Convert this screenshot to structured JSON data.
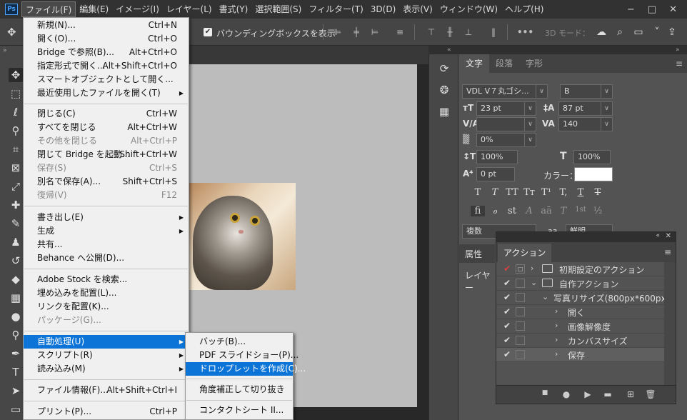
{
  "menubar": {
    "items": [
      "ファイル(F)",
      "編集(E)",
      "イメージ(I)",
      "レイヤー(L)",
      "書式(Y)",
      "選択範囲(S)",
      "フィルター(T)",
      "3D(D)",
      "表示(V)",
      "ウィンドウ(W)",
      "ヘルプ(H)"
    ],
    "logo": "Ps",
    "active_index": 0,
    "window_controls": {
      "minimize": "−",
      "maximize": "□",
      "close": "✕"
    }
  },
  "options_bar": {
    "show_bounding_box": "バウンディングボックスを表示",
    "bbox_checked": true,
    "mode_3d": "3D モード："
  },
  "file_menu": {
    "items": [
      {
        "label": "新規(N)...",
        "shortcut": "Ctrl+N"
      },
      {
        "label": "開く(O)...",
        "shortcut": "Ctrl+O"
      },
      {
        "label": "Bridge で参照(B)...",
        "shortcut": "Alt+Ctrl+O"
      },
      {
        "label": "指定形式で開く...",
        "shortcut": "Alt+Shift+Ctrl+O"
      },
      {
        "label": "スマートオブジェクトとして開く...",
        "shortcut": ""
      },
      {
        "label": "最近使用したファイルを開く(T)",
        "shortcut": "",
        "submenu": true
      },
      {
        "label": "閉じる(C)",
        "shortcut": "Ctrl+W"
      },
      {
        "label": "すべてを閉じる",
        "shortcut": "Alt+Ctrl+W"
      },
      {
        "label": "その他を閉じる",
        "shortcut": "Alt+Ctrl+P",
        "disabled": true
      },
      {
        "label": "閉じて Bridge を起動...",
        "shortcut": "Shift+Ctrl+W"
      },
      {
        "label": "保存(S)",
        "shortcut": "Ctrl+S",
        "disabled": true
      },
      {
        "label": "別名で保存(A)...",
        "shortcut": "Shift+Ctrl+S"
      },
      {
        "label": "復帰(V)",
        "shortcut": "F12",
        "disabled": true
      },
      {
        "label": "書き出し(E)",
        "shortcut": "",
        "submenu": true
      },
      {
        "label": "生成",
        "shortcut": "",
        "submenu": true
      },
      {
        "label": "共有...",
        "shortcut": ""
      },
      {
        "label": "Behance へ公開(D)...",
        "shortcut": ""
      },
      {
        "label": "Adobe Stock を検索...",
        "shortcut": ""
      },
      {
        "label": "埋め込みを配置(L)...",
        "shortcut": ""
      },
      {
        "label": "リンクを配置(K)...",
        "shortcut": ""
      },
      {
        "label": "パッケージ(G)...",
        "shortcut": "",
        "disabled": true
      },
      {
        "label": "自動処理(U)",
        "shortcut": "",
        "submenu": true,
        "highlighted": true
      },
      {
        "label": "スクリプト(R)",
        "shortcut": "",
        "submenu": true
      },
      {
        "label": "読み込み(M)",
        "shortcut": "",
        "submenu": true
      },
      {
        "label": "ファイル情報(F)...",
        "shortcut": "Alt+Shift+Ctrl+I"
      },
      {
        "label": "プリント(P)...",
        "shortcut": "Ctrl+P"
      }
    ]
  },
  "automate_submenu": {
    "items": [
      {
        "label": "バッチ(B)..."
      },
      {
        "label": "PDF スライドショー(P)..."
      },
      {
        "label": "ドロップレットを作成(C)...",
        "highlighted": true
      },
      {
        "label": "角度補正して切り抜き"
      },
      {
        "label": "コンタクトシート II..."
      }
    ]
  },
  "character_panel": {
    "tabs": [
      "文字",
      "段落",
      "字形"
    ],
    "active_tab": 0,
    "font_family": "VDL V７丸ゴシ...",
    "font_style": "B",
    "font_size": "23 pt",
    "leading": "87 pt",
    "kerning": "",
    "tracking": "140",
    "tsume": "0%",
    "vertical_scale": "100%",
    "horizontal_scale": "100%",
    "baseline_shift": "0 pt",
    "color_label": "カラー：",
    "text_color": "#ffffff",
    "style_buttons": [
      "T",
      "T",
      "TT",
      "Tт",
      "T¹",
      "T,",
      "T",
      "T"
    ],
    "opentype_buttons": [
      "fi",
      "ℴ",
      "st",
      "A",
      "aā",
      "T",
      "1st",
      "½"
    ],
    "language": "複数",
    "aa_label": "aa",
    "antialias": "鮮明"
  },
  "left_panel_tabs": {
    "properties": "属性",
    "layers": "レイヤー"
  },
  "actions_panel": {
    "title": "アクション",
    "rows": [
      {
        "label": "初期設定のアクション",
        "check": "✔",
        "red": true,
        "box": "□",
        "expand": "›",
        "folder": true
      },
      {
        "label": "自作アクション",
        "check": "✔",
        "expand": "⌄",
        "folder": true
      },
      {
        "label": "写真リサイズ(800px*600px)",
        "check": "✔",
        "expand": "⌄"
      },
      {
        "label": "開く",
        "check": "✔",
        "expand": "›"
      },
      {
        "label": "画像解像度",
        "check": "✔",
        "expand": "›"
      },
      {
        "label": "カンバスサイズ",
        "check": "✔",
        "expand": "›"
      },
      {
        "label": "保存",
        "check": "✔",
        "expand": "›",
        "selected": true
      }
    ],
    "footer_icons": [
      "stop-icon",
      "record-icon",
      "play-icon",
      "folder-icon",
      "new-icon",
      "trash-icon"
    ]
  },
  "colors": {
    "menu_highlight": "#0c74d6",
    "panel_bg": "#535353",
    "menubar_bg": "#323232",
    "red_check": "#e04040"
  }
}
